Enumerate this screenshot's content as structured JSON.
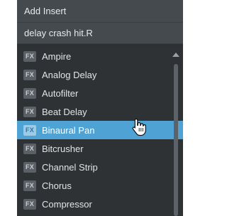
{
  "menu": {
    "header": "Add Insert",
    "subheader": "delay crash hit.R"
  },
  "items": [
    {
      "badge": "FX",
      "label": "Ampire",
      "selected": false
    },
    {
      "badge": "FX",
      "label": "Analog Delay",
      "selected": false
    },
    {
      "badge": "FX",
      "label": "Autofilter",
      "selected": false
    },
    {
      "badge": "FX",
      "label": "Beat Delay",
      "selected": false
    },
    {
      "badge": "FX",
      "label": "Binaural Pan",
      "selected": true
    },
    {
      "badge": "FX",
      "label": "Bitcrusher",
      "selected": false
    },
    {
      "badge": "FX",
      "label": "Channel Strip",
      "selected": false
    },
    {
      "badge": "FX",
      "label": "Chorus",
      "selected": false
    },
    {
      "badge": "FX",
      "label": "Compressor",
      "selected": false
    }
  ],
  "colors": {
    "panel": "#2e3133",
    "header": "#454a4f",
    "selected": "#4fa3d4"
  },
  "icons": {
    "scroll_up": "triangle-up",
    "cursor": "hand-pointer"
  }
}
